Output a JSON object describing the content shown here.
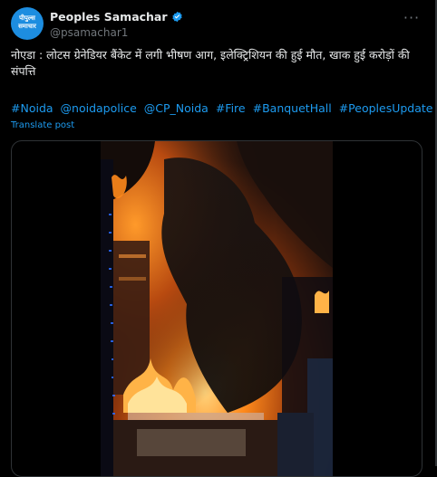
{
  "account": {
    "avatar_text_line1": "पीपुल्स",
    "avatar_text_line2": "समाचार",
    "display_name": "Peoples Samachar",
    "handle": "@psamachar1",
    "verified": true,
    "more_icon": "ellipsis-icon"
  },
  "post": {
    "text": "नोएडा : लोटस ग्रेनेडियर बैंकेट में लगी भीषण आग, इलेक्ट्रिशियन की हुई मौत, खाक हुई करोड़ों की संपत्ति",
    "tags": [
      "#Noida",
      "@noidapolice",
      "@CP_Noida",
      "#Fire",
      "#BanquetHall",
      "#PeoplesUpdate"
    ],
    "translate_label": "Translate post"
  },
  "media": {
    "type": "video",
    "content": "banquet-hall-fire-video"
  },
  "colors": {
    "background": "#000000",
    "text": "#e7e9ea",
    "link": "#1d9bf0",
    "muted": "#71767b",
    "avatar": "#1d8de0"
  }
}
